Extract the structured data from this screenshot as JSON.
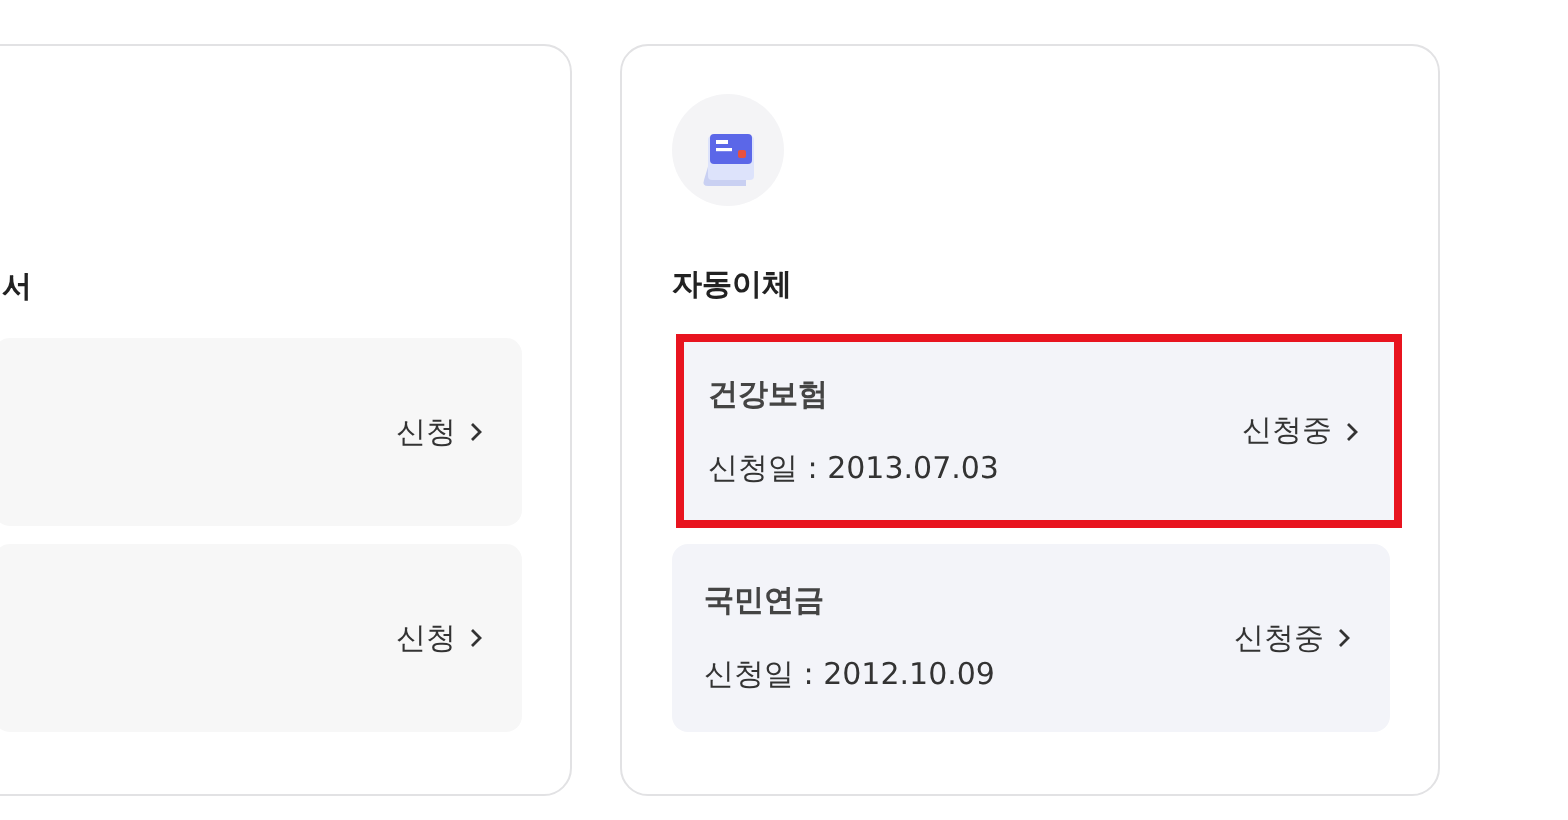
{
  "left_card": {
    "title": "서",
    "items": [
      {
        "action": "신청"
      },
      {
        "action": "신청"
      }
    ]
  },
  "auto_transfer": {
    "title": "자동이체",
    "items": [
      {
        "name": "건강보험",
        "date": "신청일 : 2013.07.03",
        "status": "신청중",
        "highlighted": true
      },
      {
        "name": "국민연금",
        "date": "신청일 : 2012.10.09",
        "status": "신청중",
        "highlighted": false
      }
    ]
  }
}
